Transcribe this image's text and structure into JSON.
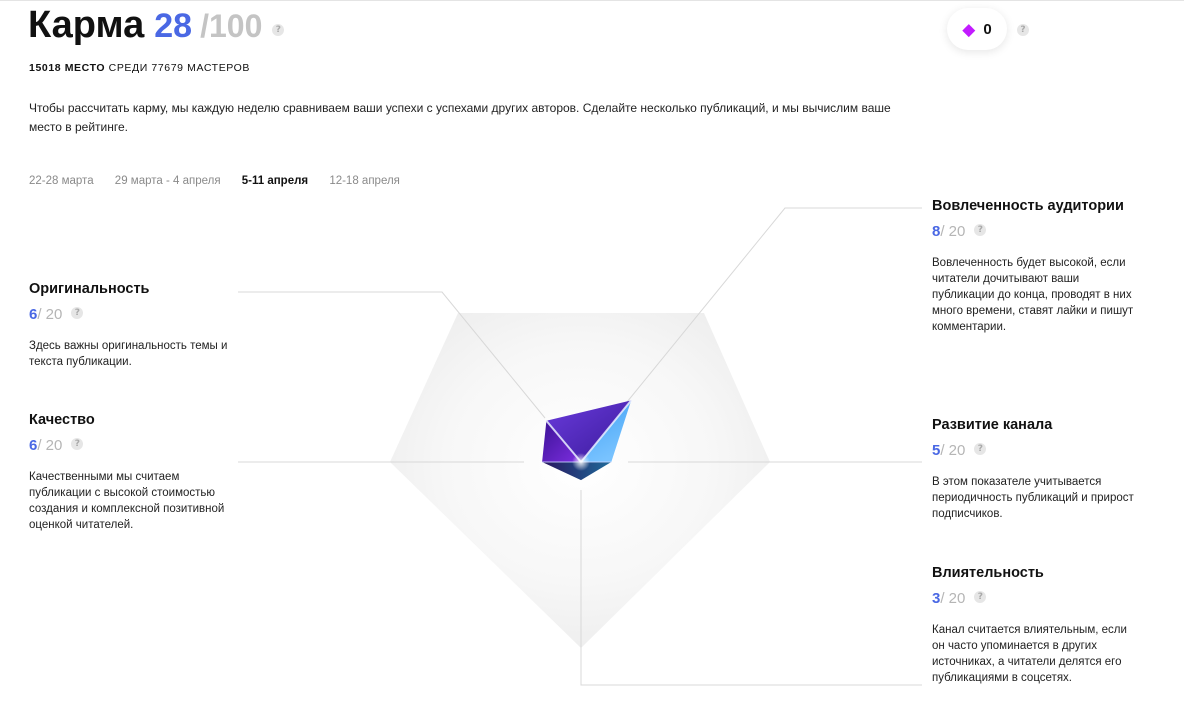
{
  "karma": {
    "title": "Карма",
    "value": "28",
    "max": "/100",
    "help": "?"
  },
  "rank": {
    "place": "15018 МЕСТО",
    "among": "СРЕДИ 77679 МАСТЕРОВ"
  },
  "description": "Чтобы рассчитать карму, мы каждую неделю сравниваем ваши успехи с успехами других авторов. Сделайте несколько публикаций, и мы вычислим ваше место в рейтинге.",
  "weeks": [
    {
      "label": "22-28 марта",
      "active": false
    },
    {
      "label": "29 марта - 4 апреля",
      "active": false
    },
    {
      "label": "5-11 апреля",
      "active": true
    },
    {
      "label": "12-18 апреля",
      "active": false
    }
  ],
  "badge": {
    "count": "0",
    "icon": "diamond-icon",
    "color": "#c21bff"
  },
  "colors": {
    "accent": "#4a68e4",
    "muted": "#b5b5b5"
  },
  "metrics": {
    "originality": {
      "name": "Оригинальность",
      "value": "6",
      "max": "/ 20",
      "description": "Здесь важны оригинальность темы и текста публикации."
    },
    "quality": {
      "name": "Качество",
      "value": "6",
      "max": "/ 20",
      "description": "Качественными мы считаем публикации с высокой стоимостью создания и комплексной позитивной оценкой читателей."
    },
    "engagement": {
      "name": "Вовлеченность аудитории",
      "value": "8",
      "max": "/ 20",
      "description": "Вовлеченность будет высокой, если читатели дочитывают ваши публикации до конца, проводят в них много времени, ставят лайки и пишут комментарии."
    },
    "growth": {
      "name": "Развитие канала",
      "value": "5",
      "max": "/ 20",
      "description": "В этом показателе учитывается периодичность публикаций и прирост подписчиков."
    },
    "influence": {
      "name": "Влиятельность",
      "value": "3",
      "max": "/ 20",
      "description": "Канал считается влиятельным, если он часто упоминается в других источниках, а читатели делятся его публикациями в соцсетях."
    }
  }
}
